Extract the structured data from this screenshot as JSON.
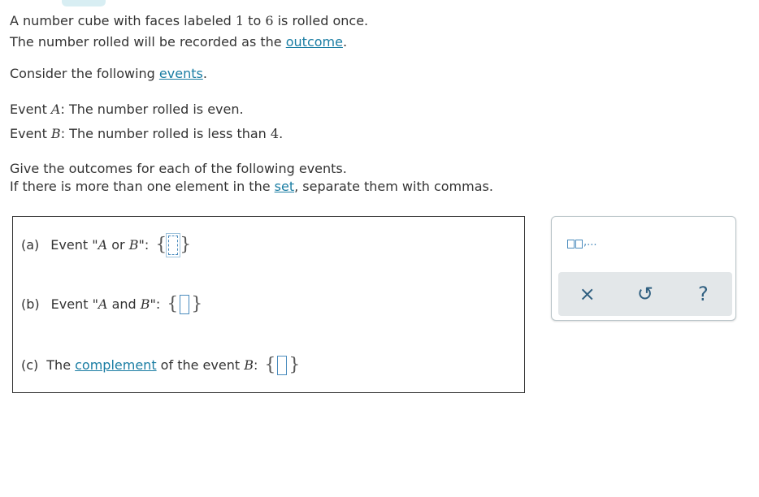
{
  "intro": {
    "line1_pre": "A number cube with faces labeled ",
    "n1": "1",
    "line1_mid": " to ",
    "n6": "6",
    "line1_post": " is rolled once.",
    "line2_pre": "The number rolled will be recorded as the ",
    "outcome_link": "outcome",
    "line2_post": ".",
    "line3_pre": "Consider the following ",
    "events_link": "events",
    "line3_post": "."
  },
  "events": {
    "a_prefix": "Event ",
    "a_var": "A",
    "a_text": ": The number rolled is even.",
    "b_prefix": "Event ",
    "b_var": "B",
    "b_text": ": The number rolled is less than ",
    "b_num": "4",
    "b_end": "."
  },
  "instructions": {
    "line1": "Give the outcomes for each of the following events.",
    "line2_pre": "If there is more than one element in the ",
    "set_link": "set",
    "line2_post": ", separate them with commas."
  },
  "questions": {
    "a_label": "(a)",
    "a_pre": "Event \"",
    "a_var1": "A",
    "a_mid": " or ",
    "a_var2": "B",
    "a_post": "\":",
    "b_label": "(b)",
    "b_pre": "Event \"",
    "b_var1": "A",
    "b_mid": " and ",
    "b_var2": "B",
    "b_post": "\":",
    "c_label": "(c)",
    "c_pre": "The ",
    "c_link": "complement",
    "c_mid": " of the event ",
    "c_var": "B",
    "c_post": ":",
    "brace_open": "{",
    "brace_close": "}"
  },
  "toolbox": {
    "template_label": ",...",
    "clear_icon": "×",
    "undo_icon": "↺",
    "help_icon": "?",
    "icons": [
      "set-template-icon",
      "clear-icon",
      "undo-icon",
      "help-icon"
    ]
  },
  "colors": {
    "link": "#1a7da3",
    "slot": "#4a8bbd",
    "toolbar": "#e3e7e9"
  }
}
